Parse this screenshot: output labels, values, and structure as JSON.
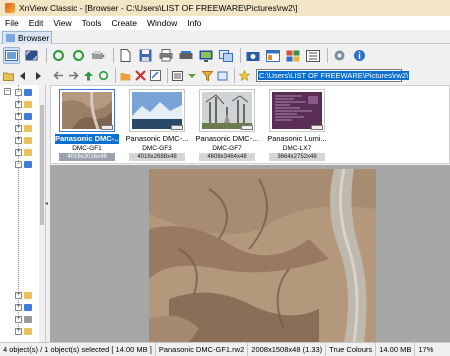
{
  "window": {
    "title": "XnView Classic - [Browser - C:\\Users\\LIST OF FREEWARE\\Pictures\\rw2\\]"
  },
  "menu": [
    "File",
    "Edit",
    "View",
    "Tools",
    "Create",
    "Window",
    "Info"
  ],
  "tab": {
    "label": "Browser"
  },
  "path": {
    "value": "C:\\Users\\LIST OF FREEWARE\\Pictures\\rw2\\"
  },
  "thumbnails": [
    {
      "name": "Panasonic DMC-...",
      "model": "DMC-GF1",
      "dims": "4016x3016x48",
      "selected": true
    },
    {
      "name": "Panasonic DMC-...",
      "model": "DMC-GF3",
      "dims": "4016x2688x48",
      "selected": false
    },
    {
      "name": "Panasonic DMC-...",
      "model": "DMC-GF7",
      "dims": "4608x3464x48",
      "selected": false
    },
    {
      "name": "Panasonic Lumi...",
      "model": "DMC-LX7",
      "dims": "3664x2752x48",
      "selected": false
    }
  ],
  "status": {
    "objects": "4 object(s) / 1 object(s) selected",
    "size_total": "[ 14.00 MB ]",
    "filename": "Panasonic DMC-GF1.rw2",
    "dimensions": "2008x1508x48 (1.33)",
    "colour": "True Colours",
    "filesize": "14.00 MB",
    "zoom": "17%"
  },
  "colors": {
    "selection": "#0b6fd0",
    "title_bar": "#f3e6c7",
    "preview_bg": "#a7a7a7"
  }
}
